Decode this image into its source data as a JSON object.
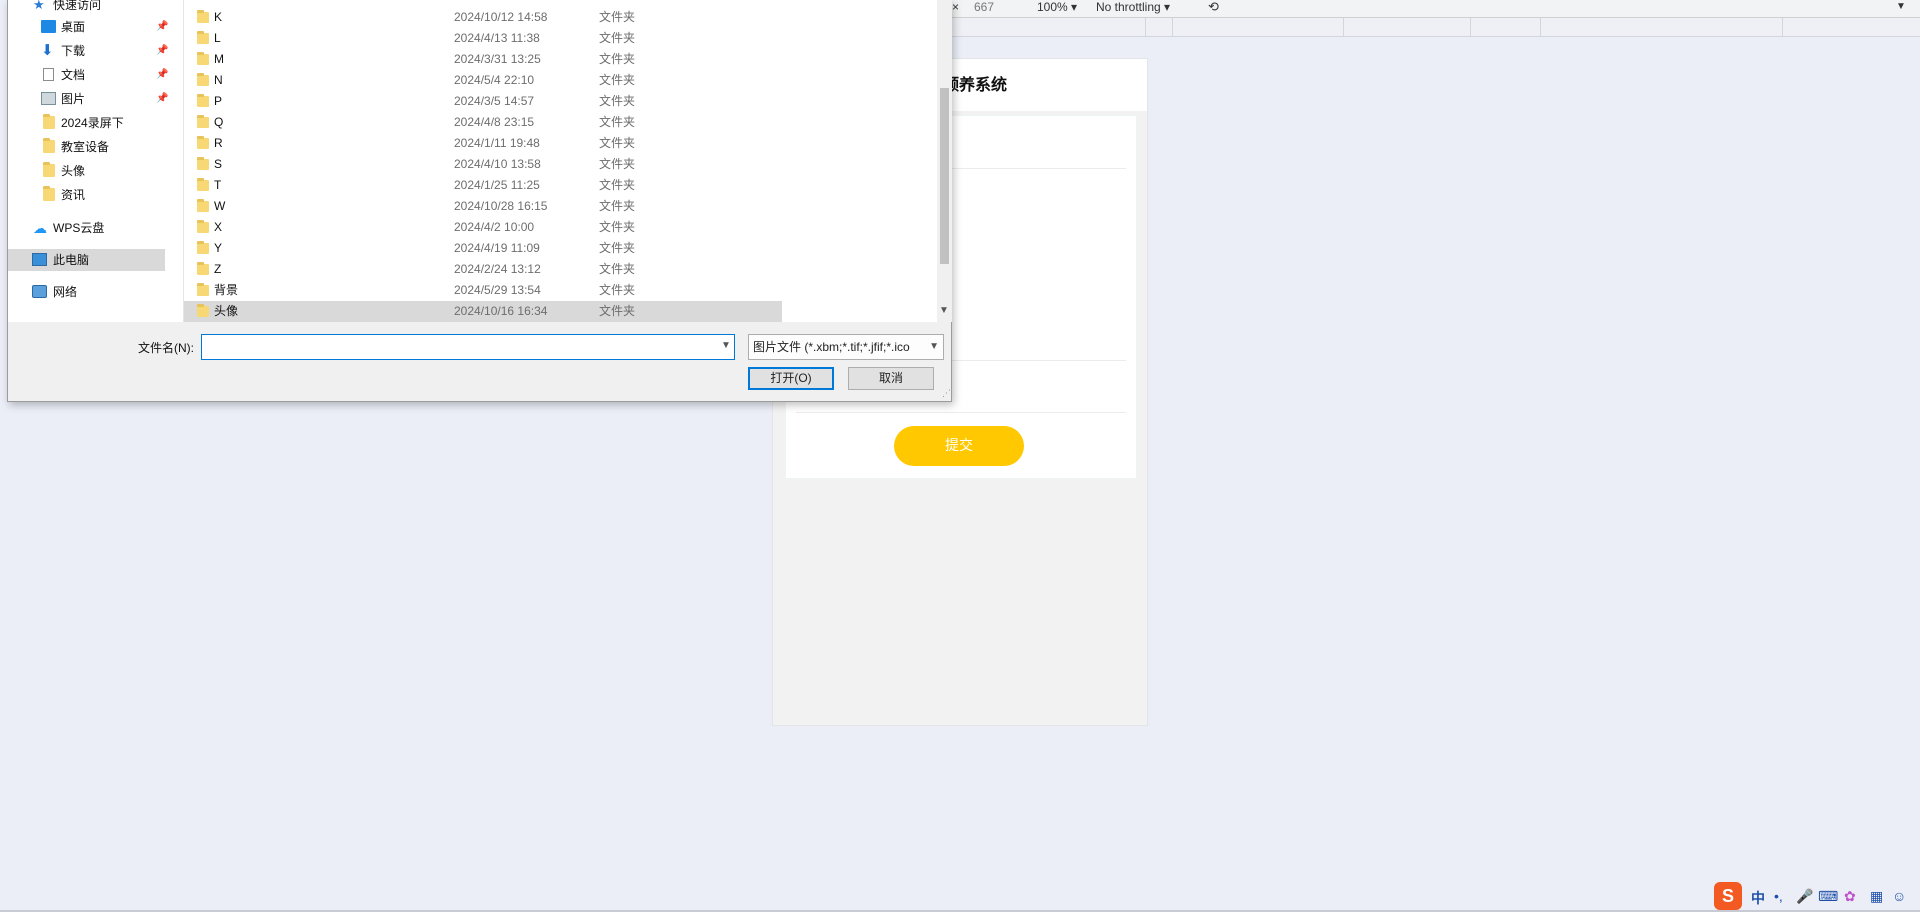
{
  "devtools": {
    "close_glyph": "×",
    "height_value": "667",
    "zoom": "100%",
    "throttling": "No throttling",
    "rotate_icon": "rotate-icon",
    "more_icon": "chevron-down-icon"
  },
  "phone": {
    "title_partial": "颐养系统",
    "submit_label": "提交"
  },
  "dialog": {
    "nav": [
      {
        "label": "快速访问",
        "icon": "star-icon"
      },
      {
        "label": "桌面",
        "icon": "desktop-icon",
        "pinned": true
      },
      {
        "label": "下载",
        "icon": "download-icon",
        "pinned": true
      },
      {
        "label": "文档",
        "icon": "document-icon",
        "pinned": true
      },
      {
        "label": "图片",
        "icon": "picture-icon",
        "pinned": true
      },
      {
        "label": "2024录屏下",
        "icon": "folder-icon"
      },
      {
        "label": "教室设备",
        "icon": "folder-icon"
      },
      {
        "label": "头像",
        "icon": "folder-icon"
      },
      {
        "label": "资讯",
        "icon": "folder-icon"
      },
      {
        "label": "WPS云盘",
        "icon": "cloud-icon"
      },
      {
        "label": "此电脑",
        "icon": "computer-icon",
        "selected": true
      },
      {
        "label": "网络",
        "icon": "network-icon"
      }
    ],
    "files": [
      {
        "name": "K",
        "date": "2024/10/12 14:58",
        "type": "文件夹"
      },
      {
        "name": "L",
        "date": "2024/4/13 11:38",
        "type": "文件夹"
      },
      {
        "name": "M",
        "date": "2024/3/31 13:25",
        "type": "文件夹"
      },
      {
        "name": "N",
        "date": "2024/5/4 22:10",
        "type": "文件夹"
      },
      {
        "name": "P",
        "date": "2024/3/5 14:57",
        "type": "文件夹"
      },
      {
        "name": "Q",
        "date": "2024/4/8 23:15",
        "type": "文件夹"
      },
      {
        "name": "R",
        "date": "2024/1/11 19:48",
        "type": "文件夹"
      },
      {
        "name": "S",
        "date": "2024/4/10 13:58",
        "type": "文件夹"
      },
      {
        "name": "T",
        "date": "2024/1/25 11:25",
        "type": "文件夹"
      },
      {
        "name": "W",
        "date": "2024/10/28 16:15",
        "type": "文件夹"
      },
      {
        "name": "X",
        "date": "2024/4/2 10:00",
        "type": "文件夹"
      },
      {
        "name": "Y",
        "date": "2024/4/19 11:09",
        "type": "文件夹"
      },
      {
        "name": "Z",
        "date": "2024/2/24 13:12",
        "type": "文件夹"
      },
      {
        "name": "背景",
        "date": "2024/5/29 13:54",
        "type": "文件夹"
      },
      {
        "name": "头像",
        "date": "2024/10/16 16:34",
        "type": "文件夹",
        "selected": true
      }
    ],
    "filename_label": "文件名(N):",
    "filename_value": "",
    "filetype_label": "图片文件 (*.xbm;*.tif;*.jfif;*.ico",
    "open_label": "打开(O)",
    "cancel_label": "取消"
  },
  "tray": {
    "ime_logo": "S",
    "ime_mode": "中",
    "items": [
      "punctuation-icon",
      "microphone-icon",
      "keyboard-icon",
      "skin-icon",
      "grid-icon",
      "emoji-icon"
    ],
    "colors": {
      "ime": "#f25a22",
      "accent": "#1e4fa8"
    }
  }
}
